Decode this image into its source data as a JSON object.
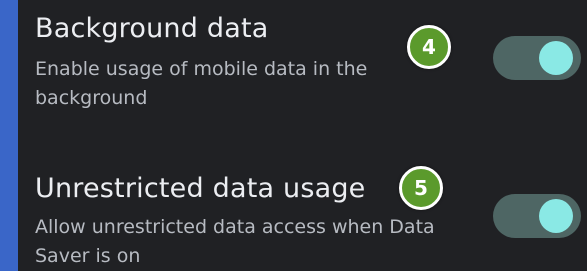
{
  "settings": [
    {
      "title": "Background data",
      "description": "Enable usage of mobile data in the background",
      "enabled": true
    },
    {
      "title": "Unrestricted data usage",
      "description": "Allow unrestricted data access when Data Saver is on",
      "enabled": true
    }
  ],
  "badges": [
    "4",
    "5"
  ],
  "colors": {
    "background": "#202124",
    "frame": "#3a66c8",
    "toggle_track": "#4e6664",
    "toggle_thumb": "#8ae9e5",
    "badge": "#5b9a2c"
  }
}
